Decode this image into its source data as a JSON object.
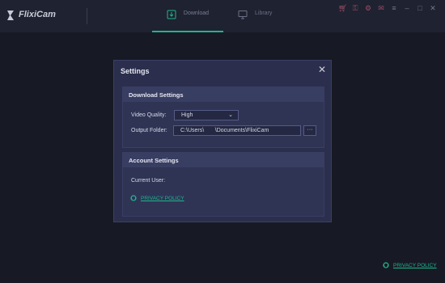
{
  "app": {
    "name": "FlixiCam"
  },
  "nav": {
    "tabs": [
      {
        "label": "Download",
        "icon": "download-icon",
        "active": true
      },
      {
        "label": "Library",
        "icon": "monitor-icon",
        "active": false
      }
    ]
  },
  "toolbar_icons": [
    "cart-icon",
    "key-icon",
    "settings-icon",
    "mail-icon",
    "menu-icon",
    "minimize-icon",
    "maximize-icon",
    "close-icon"
  ],
  "dialog": {
    "title": "Settings",
    "close_glyph": "✕",
    "download_settings": {
      "heading": "Download Settings",
      "video_quality_label": "Video Quality:",
      "video_quality_value": "High",
      "output_folder_label": "Output Folder:",
      "output_folder_value": "C:\\Users\\       \\Documents\\FlixiCam",
      "browse_label": "···"
    },
    "account_settings": {
      "heading": "Account Settings",
      "current_user_label": "Current User:",
      "privacy_link": "PRIVACY POLICY"
    }
  },
  "footer": {
    "privacy_link": "PRIVACY POLICY"
  },
  "colors": {
    "accent": "#1fb58d",
    "background": "#1b1e29",
    "dialog": "#2b2f4d"
  }
}
